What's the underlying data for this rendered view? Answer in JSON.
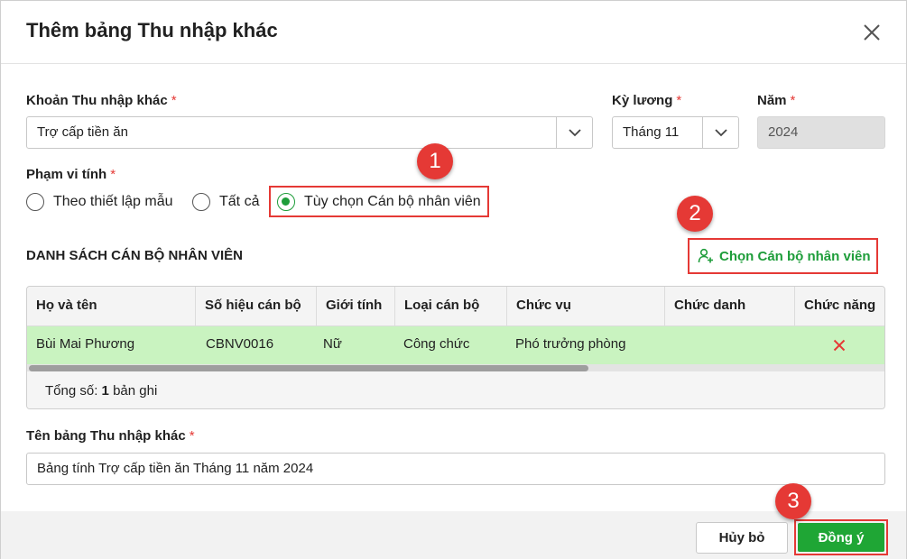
{
  "dialog": {
    "title": "Thêm bảng Thu nhập khác"
  },
  "form": {
    "income_item": {
      "label": "Khoản Thu nhập khác",
      "required": "*",
      "value": "Trợ cấp tiền ăn"
    },
    "pay_period": {
      "label": "Kỳ lương",
      "required": "*",
      "value": "Tháng 11"
    },
    "year": {
      "label": "Năm",
      "required": "*",
      "value": "2024"
    },
    "scope": {
      "label": "Phạm vi tính",
      "required": "*",
      "options": [
        "Theo thiết lập mẫu",
        "Tất cả",
        "Tùy chọn Cán bộ nhân viên"
      ],
      "selected": "Tùy chọn Cán bộ nhân viên"
    },
    "table_name": {
      "label": "Tên bảng Thu nhập khác",
      "required": "*",
      "value": "Bảng tính Trợ cấp tiền ăn Tháng 11 năm 2024"
    }
  },
  "employees": {
    "section_title": "DANH SÁCH CÁN BỘ NHÂN VIÊN",
    "pick_button": "Chọn Cán bộ nhân viên",
    "columns": [
      "Họ và tên",
      "Số hiệu cán bộ",
      "Giới tính",
      "Loại cán bộ",
      "Chức vụ",
      "Chức danh",
      "Chức năng"
    ],
    "rows": [
      {
        "name": "Bùi Mai Phương",
        "code": "CBNV0016",
        "gender": "Nữ",
        "type": "Công chức",
        "position": "Phó trưởng phòng",
        "title": ""
      }
    ],
    "total_label": "Tổng số:",
    "total_count": "1",
    "total_unit": "bản ghi"
  },
  "annotations": {
    "step1": "1",
    "step2": "2",
    "step3": "3"
  },
  "footer": {
    "cancel": "Hủy bỏ",
    "ok": "Đồng ý"
  },
  "colors": {
    "accent": "#1fa635",
    "highlight": "#e53935",
    "row_selected": "#c9f3c0"
  },
  "icons": {
    "close": "close-icon",
    "dropdown": "chevron-down-icon",
    "add_user": "add-user-icon",
    "delete": "delete-x-icon"
  }
}
